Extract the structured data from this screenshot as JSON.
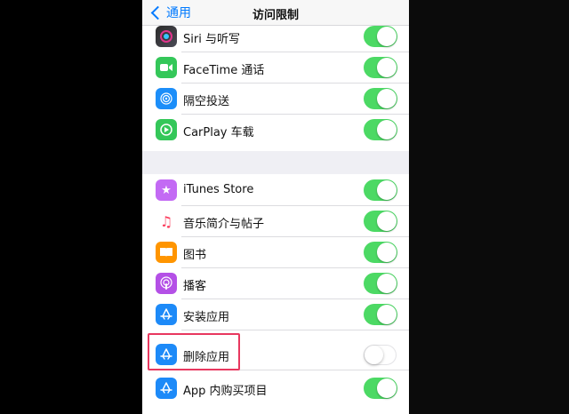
{
  "nav": {
    "back_label": "通用",
    "title": "访问限制"
  },
  "colors": {
    "toggle_on": "#4cd964",
    "accent": "#007aff",
    "highlight": "#e8385f"
  },
  "group1": [
    {
      "label": "Siri 与听写",
      "icon": "siri-icon",
      "on": true
    },
    {
      "label": "FaceTime 通话",
      "icon": "facetime-icon",
      "on": true
    },
    {
      "label": "隔空投送",
      "icon": "airdrop-icon",
      "on": true
    },
    {
      "label": "CarPlay 车载",
      "icon": "carplay-icon",
      "on": true
    }
  ],
  "group2": [
    {
      "label": "iTunes Store",
      "icon": "itunes-store-icon",
      "on": true
    },
    {
      "label": "音乐简介与帖子",
      "icon": "music-note-icon",
      "on": true
    },
    {
      "label": "图书",
      "icon": "books-icon",
      "on": true
    },
    {
      "label": "播客",
      "icon": "podcasts-icon",
      "on": true
    },
    {
      "label": "安装应用",
      "icon": "app-store-icon",
      "on": true
    },
    {
      "label": "删除应用",
      "icon": "app-store-icon",
      "on": false
    },
    {
      "label": "App 内购买项目",
      "icon": "app-store-icon",
      "on": true
    }
  ]
}
